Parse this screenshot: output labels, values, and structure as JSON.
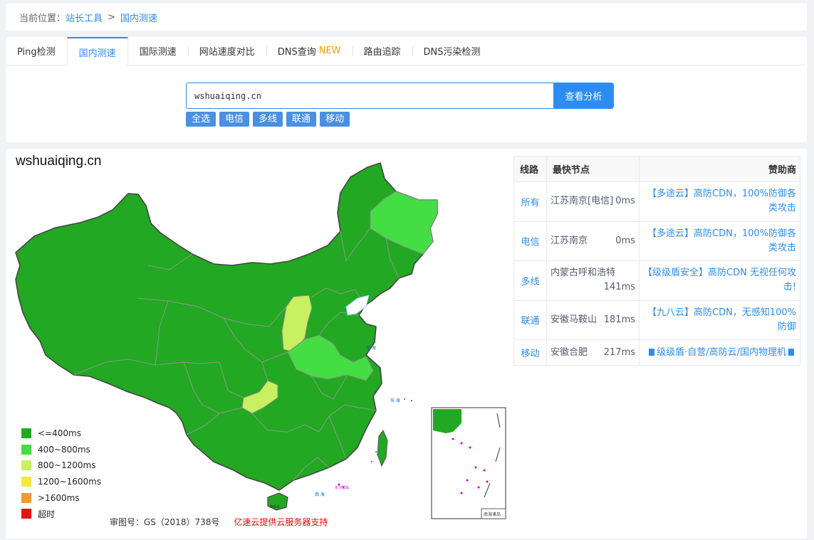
{
  "breadcrumb": {
    "prefix": "当前位置：",
    "items": [
      "站长工具",
      "国内测速"
    ],
    "sep": ">"
  },
  "tabs": [
    {
      "label": "Ping检测",
      "active": false
    },
    {
      "label": "国内测速",
      "active": true
    },
    {
      "label": "国际测速",
      "active": false
    },
    {
      "label": "网站速度对比",
      "active": false
    },
    {
      "label": "DNS查询",
      "badge": "NEW",
      "active": false
    },
    {
      "label": "路由追踪",
      "active": false
    },
    {
      "label": "DNS污染检测",
      "active": false
    }
  ],
  "search": {
    "value": "wshuaiqing.cn",
    "button": "查看分析"
  },
  "filters": [
    "全选",
    "电信",
    "多线",
    "联通",
    "移动"
  ],
  "result": {
    "domain": "wshuaiqing.cn",
    "legend": [
      {
        "label": "<=400ms",
        "color": "#22a822"
      },
      {
        "label": "400~800ms",
        "color": "#44dd44"
      },
      {
        "label": "800~1200ms",
        "color": "#c8f060"
      },
      {
        "label": "1200~1600ms",
        "color": "#f4e83a"
      },
      {
        "label": ">1600ms",
        "color": "#f39c2b"
      },
      {
        "label": "超时",
        "color": "#e81010"
      }
    ],
    "map_labels": {
      "south_sea": "南海诸岛",
      "hainan": "海南岛",
      "dongsha": "东沙群岛"
    },
    "footer": {
      "review_no": "审图号：GS（2018）738号",
      "sponsor": "亿速云提供云服务器支持"
    }
  },
  "table": {
    "headers": {
      "line": "线路",
      "node": "最快节点",
      "sponsor": "赞助商"
    },
    "rows": [
      {
        "line": "所有",
        "node": "江苏南京[电信]",
        "ms": "0ms",
        "wrap": false,
        "sponsor": "【多途云】高防CDN，100%防御各类攻击"
      },
      {
        "line": "电信",
        "node": "江苏南京",
        "ms": "0ms",
        "wrap": false,
        "sponsor": "【多途云】高防CDN，100%防御各类攻击"
      },
      {
        "line": "多线",
        "node": "内蒙古呼和浩特",
        "ms": "141ms",
        "wrap": true,
        "sponsor": "【级级盾安全】高防CDN 无视任何攻击!"
      },
      {
        "line": "联通",
        "node": "安徽马鞍山",
        "ms": "181ms",
        "wrap": false,
        "sponsor": "【九八云】高防CDN，无感知100%防御"
      },
      {
        "line": "移动",
        "node": "安徽合肥",
        "ms": "217ms",
        "wrap": false,
        "sponsor": "级级盾·自营/高防云/国内物理机"
      }
    ]
  }
}
